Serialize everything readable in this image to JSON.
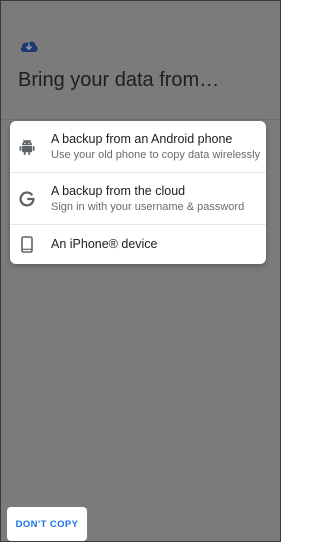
{
  "header": {
    "icon": "cloud-download-icon",
    "title": "Bring your data from…"
  },
  "options": [
    {
      "icon": "android-icon",
      "label": "A backup from an Android phone",
      "sublabel": "Use your old phone to copy data wirelessly"
    },
    {
      "icon": "google-icon",
      "label": "A backup from the cloud",
      "sublabel": "Sign in with your username & password"
    },
    {
      "icon": "phone-icon",
      "label": "An iPhone® device"
    }
  ],
  "footer": {
    "dont_copy_label": "DON'T COPY"
  },
  "colors": {
    "accent": "#1a73e8",
    "scrim": "#7b7b7b",
    "sheet": "#ffffff"
  }
}
